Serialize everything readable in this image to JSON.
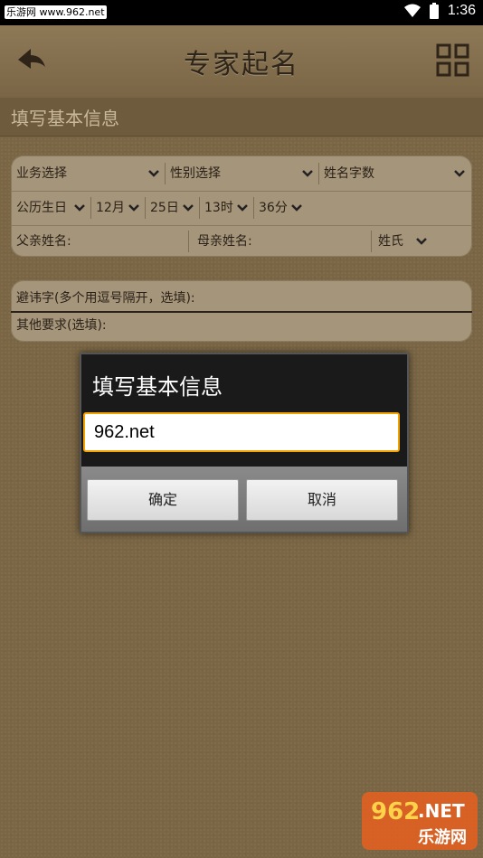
{
  "status_bar": {
    "watermark": "乐游网 www.962.net",
    "time": "1:36"
  },
  "header": {
    "title": "专家起名",
    "back_icon": "back-arrow-icon",
    "grid_icon": "grid-menu-icon"
  },
  "section": {
    "title": "填写基本信息"
  },
  "form": {
    "row1": {
      "business": "业务选择",
      "gender": "性别选择",
      "name_length": "姓名字数"
    },
    "row2": {
      "calendar": "公历生日",
      "month": "12月",
      "day": "25日",
      "hour": "13时",
      "minute": "36分"
    },
    "row3": {
      "father_label": "父亲姓名:",
      "mother_label": "母亲姓名:",
      "surname": "姓氏"
    },
    "avoid_label": "避讳字(多个用逗号隔开，选填):",
    "other_label": "其他要求(选填):"
  },
  "dialog": {
    "title": "填写基本信息",
    "input_value": "962.net",
    "ok_label": "确定",
    "cancel_label": "取消"
  },
  "watermark": {
    "top": "962",
    "top_suffix": ".NET",
    "bottom": "乐游网"
  }
}
